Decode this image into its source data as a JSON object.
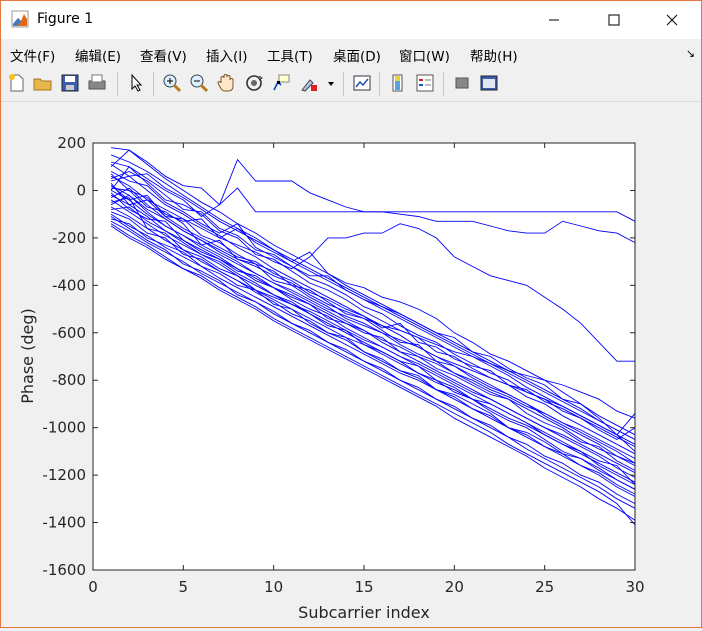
{
  "window": {
    "title": "Figure 1",
    "minimize": "—",
    "maximize": "☐",
    "close": "✕"
  },
  "menu": {
    "items": [
      "文件(F)",
      "编辑(E)",
      "查看(V)",
      "插入(I)",
      "工具(T)",
      "桌面(D)",
      "窗口(W)",
      "帮助(H)"
    ],
    "overflow": "↘"
  },
  "toolbar": {
    "icons": [
      "new-figure-icon",
      "open-file-icon",
      "save-icon",
      "print-icon",
      "select-arrow-icon",
      "zoom-in-icon",
      "zoom-out-icon",
      "pan-hand-icon",
      "rotate-3d-icon",
      "data-cursor-icon",
      "brush-icon",
      "brush-dropdown-icon",
      "link-plot-icon",
      "colorbar-icon",
      "legend-icon",
      "hide-plot-tools-icon",
      "show-plot-tools-icon"
    ]
  },
  "chart_data": {
    "type": "line",
    "title": "",
    "xlabel": "Subcarrier index",
    "ylabel": "Phase (deg)",
    "xlim": [
      0,
      30
    ],
    "ylim": [
      -1600,
      200
    ],
    "xticks": [
      0,
      5,
      10,
      15,
      20,
      25,
      30
    ],
    "yticks": [
      200,
      0,
      -200,
      -400,
      -600,
      -800,
      -1000,
      -1200,
      -1400,
      -1600
    ],
    "line_color": "#0000ff",
    "grid": false,
    "x": [
      1,
      2,
      3,
      4,
      5,
      6,
      7,
      8,
      9,
      10,
      11,
      12,
      13,
      14,
      15,
      16,
      17,
      18,
      19,
      20,
      21,
      22,
      23,
      24,
      25,
      26,
      27,
      28,
      29,
      30
    ],
    "series": [
      {
        "values": [
          180,
          170,
          120,
          60,
          20,
          10,
          -60,
          130,
          40,
          40,
          40,
          -10,
          -40,
          -70,
          -90,
          -90,
          -90,
          -90,
          -90,
          -90,
          -90,
          -90,
          -90,
          -90,
          -90,
          -90,
          -90,
          -90,
          -90,
          -130
        ]
      },
      {
        "values": [
          120,
          100,
          50,
          0,
          -40,
          -110,
          -60,
          10,
          -90,
          -90,
          -90,
          -90,
          -90,
          -90,
          -90,
          -90,
          -100,
          -110,
          -130,
          -130,
          -130,
          -150,
          -170,
          -180,
          -180,
          -130,
          -150,
          -170,
          -180,
          -220
        ]
      },
      {
        "values": [
          60,
          20,
          -40,
          -80,
          -120,
          -160,
          -200,
          -230,
          -260,
          -300,
          -330,
          -280,
          -200,
          -200,
          -180,
          -180,
          -140,
          -160,
          -200,
          -280,
          -320,
          -360,
          -380,
          -400,
          -450,
          -500,
          -560,
          -640,
          -720,
          -720
        ]
      },
      {
        "values": [
          20,
          -20,
          -80,
          -120,
          -170,
          -210,
          -250,
          -290,
          -320,
          -360,
          -390,
          -440,
          -480,
          -510,
          -540,
          -570,
          -590,
          -620,
          -650,
          -680,
          -700,
          -730,
          -760,
          -780,
          -800,
          -820,
          -850,
          -880,
          -930,
          -960
        ]
      },
      {
        "values": [
          0,
          -40,
          -100,
          -150,
          -190,
          -230,
          -270,
          -310,
          -350,
          -390,
          -420,
          -460,
          -500,
          -530,
          -560,
          -600,
          -630,
          -660,
          -700,
          -730,
          -760,
          -790,
          -820,
          -850,
          -880,
          -910,
          -950,
          -990,
          -1030,
          -1070
        ]
      },
      {
        "values": [
          -20,
          -60,
          -110,
          -170,
          -210,
          -250,
          -290,
          -330,
          -370,
          -410,
          -450,
          -480,
          -520,
          -560,
          -590,
          -630,
          -660,
          -700,
          -730,
          -770,
          -800,
          -840,
          -870,
          -910,
          -940,
          -980,
          -1010,
          -1050,
          -1090,
          -1130
        ]
      },
      {
        "values": [
          -40,
          -90,
          -140,
          -190,
          -230,
          -270,
          -310,
          -360,
          -400,
          -440,
          -480,
          -510,
          -550,
          -590,
          -630,
          -660,
          -700,
          -730,
          -770,
          -810,
          -850,
          -880,
          -920,
          -960,
          -1000,
          -1030,
          -1070,
          -1110,
          -1150,
          -1190
        ]
      },
      {
        "values": [
          -70,
          -110,
          -160,
          -210,
          -250,
          -300,
          -340,
          -380,
          -420,
          -460,
          -500,
          -540,
          -580,
          -620,
          -650,
          -690,
          -730,
          -770,
          -810,
          -840,
          -880,
          -920,
          -960,
          -990,
          -1030,
          -1070,
          -1110,
          -1150,
          -1190,
          -1230
        ]
      },
      {
        "values": [
          -100,
          -150,
          -190,
          -240,
          -280,
          -320,
          -370,
          -410,
          -450,
          -490,
          -530,
          -570,
          -610,
          -650,
          -690,
          -730,
          -770,
          -800,
          -840,
          -880,
          -920,
          -960,
          -1000,
          -1040,
          -1080,
          -1120,
          -1160,
          -1200,
          -1250,
          -1290
        ]
      },
      {
        "values": [
          -130,
          -170,
          -220,
          -260,
          -300,
          -350,
          -390,
          -430,
          -470,
          -520,
          -560,
          -600,
          -640,
          -680,
          -720,
          -760,
          -800,
          -840,
          -880,
          -920,
          -960,
          -1000,
          -1040,
          -1090,
          -1130,
          -1170,
          -1210,
          -1250,
          -1300,
          -1340
        ]
      },
      {
        "values": [
          -150,
          -200,
          -240,
          -290,
          -330,
          -370,
          -420,
          -460,
          -500,
          -550,
          -590,
          -630,
          -670,
          -710,
          -750,
          -790,
          -830,
          -870,
          -910,
          -960,
          -1000,
          -1040,
          -1080,
          -1120,
          -1170,
          -1210,
          -1250,
          -1300,
          -1340,
          -1390
        ]
      },
      {
        "values": [
          10,
          0,
          -30,
          -100,
          -130,
          -120,
          -200,
          -160,
          -220,
          -260,
          -300,
          -260,
          -350,
          -390,
          -410,
          -450,
          -470,
          -500,
          -540,
          -600,
          -640,
          -690,
          -720,
          -760,
          -800,
          -850,
          -900,
          -960,
          -1030,
          -1100
        ]
      },
      {
        "values": [
          80,
          40,
          20,
          -50,
          -90,
          -140,
          -180,
          -140,
          -240,
          -280,
          -320,
          -360,
          -360,
          -420,
          -460,
          -490,
          -520,
          -560,
          -600,
          -620,
          -680,
          -700,
          -750,
          -790,
          -820,
          -880,
          -900,
          -950,
          -990,
          -1030
        ]
      },
      {
        "values": [
          30,
          -60,
          -40,
          -110,
          -160,
          -200,
          -240,
          -280,
          -300,
          -350,
          -380,
          -430,
          -460,
          -500,
          -530,
          -580,
          -560,
          -640,
          -660,
          -710,
          -740,
          -760,
          -820,
          -840,
          -890,
          -920,
          -960,
          -1000,
          -1040,
          -1080
        ]
      },
      {
        "values": [
          -10,
          -80,
          -120,
          -130,
          -210,
          -260,
          -290,
          -340,
          -360,
          -410,
          -440,
          -480,
          -540,
          -560,
          -600,
          -620,
          -680,
          -700,
          -750,
          -780,
          -820,
          -860,
          -880,
          -940,
          -980,
          -1010,
          -1060,
          -1080,
          -1140,
          -1180
        ]
      },
      {
        "values": [
          -50,
          -30,
          -160,
          -180,
          -250,
          -280,
          -330,
          -360,
          -420,
          -450,
          -480,
          -520,
          -560,
          -600,
          -640,
          -680,
          -720,
          -740,
          -800,
          -830,
          -880,
          -900,
          -940,
          -980,
          -1020,
          -1060,
          -1100,
          -1140,
          -1160,
          -1240
        ]
      },
      {
        "values": [
          -120,
          -140,
          -200,
          -230,
          -260,
          -320,
          -350,
          -400,
          -420,
          -480,
          -500,
          -560,
          -600,
          -620,
          -680,
          -720,
          -760,
          -780,
          -840,
          -860,
          -900,
          -940,
          -1000,
          -1020,
          -1060,
          -1110,
          -1130,
          -1180,
          -1220,
          -1260
        ]
      },
      {
        "values": [
          150,
          120,
          80,
          30,
          -20,
          -70,
          -120,
          -160,
          -200,
          -250,
          -290,
          -330,
          -370,
          -410,
          -450,
          -490,
          -530,
          -570,
          -610,
          -650,
          -690,
          -730,
          -770,
          -810,
          -850,
          -890,
          -930,
          -970,
          -1010,
          -1050
        ]
      },
      {
        "values": [
          100,
          170,
          110,
          50,
          0,
          -50,
          -90,
          -140,
          -180,
          -230,
          -270,
          -310,
          -350,
          -400,
          -440,
          -480,
          -520,
          -560,
          -600,
          -640,
          -680,
          -720,
          -760,
          -800,
          -840,
          -880,
          -920,
          -970,
          -1010,
          -1050
        ]
      },
      {
        "values": [
          40,
          60,
          0,
          -60,
          -100,
          -150,
          -190,
          -240,
          -280,
          -330,
          -370,
          -410,
          -450,
          -490,
          -530,
          -570,
          -610,
          -660,
          -700,
          -740,
          -780,
          -820,
          -860,
          -900,
          -940,
          -980,
          -1020,
          -1060,
          -1100,
          -1150
        ]
      },
      {
        "values": [
          -30,
          10,
          -60,
          -120,
          -170,
          -210,
          -260,
          -300,
          -350,
          -390,
          -430,
          -470,
          -510,
          -550,
          -590,
          -640,
          -680,
          -720,
          -760,
          -800,
          -840,
          -880,
          -920,
          -960,
          -1000,
          -1040,
          -1080,
          -1120,
          -1170,
          -1210
        ]
      },
      {
        "values": [
          70,
          0,
          -70,
          -90,
          -140,
          -230,
          -210,
          -290,
          -310,
          -380,
          -400,
          -450,
          -490,
          -540,
          -570,
          -600,
          -650,
          -690,
          -720,
          -770,
          -810,
          -850,
          -880,
          -920,
          -960,
          -1000,
          -1050,
          -1090,
          -1120,
          -1160
        ]
      },
      {
        "values": [
          0,
          100,
          30,
          -40,
          -60,
          -100,
          -170,
          -200,
          -270,
          -290,
          -340,
          -390,
          -420,
          -460,
          -510,
          -550,
          -590,
          -620,
          -680,
          -700,
          -750,
          -790,
          -820,
          -870,
          -900,
          -950,
          -990,
          -1030,
          -1070,
          -1110
        ]
      },
      {
        "values": [
          -60,
          -20,
          -90,
          -150,
          -190,
          -240,
          -280,
          -330,
          -380,
          -410,
          -460,
          -500,
          -530,
          -580,
          -620,
          -660,
          -700,
          -740,
          -780,
          -820,
          -860,
          -900,
          -940,
          -980,
          -1030,
          -1070,
          -1100,
          -1160,
          -1200,
          -1240
        ]
      },
      {
        "values": [
          -90,
          -120,
          -180,
          -200,
          -270,
          -290,
          -340,
          -380,
          -430,
          -470,
          -520,
          -550,
          -600,
          -630,
          -680,
          -710,
          -760,
          -790,
          -840,
          -870,
          -920,
          -950,
          -1000,
          -1030,
          -1080,
          -1110,
          -1160,
          -1190,
          -1240,
          -1280
        ]
      },
      {
        "values": [
          20,
          -40,
          -20,
          -110,
          -120,
          -190,
          -220,
          -270,
          -310,
          -340,
          -400,
          -420,
          -470,
          -520,
          -540,
          -590,
          -640,
          -650,
          -720,
          -740,
          -790,
          -830,
          -860,
          -900,
          -950,
          -990,
          -1030,
          -1070,
          -1120,
          -1150
        ]
      },
      {
        "values": [
          -110,
          -160,
          -210,
          -250,
          -310,
          -340,
          -380,
          -440,
          -470,
          -510,
          -560,
          -590,
          -640,
          -670,
          -720,
          -750,
          -800,
          -830,
          -880,
          -910,
          -960,
          -990,
          -1040,
          -1070,
          -1120,
          -1150,
          -1200,
          -1230,
          -1280,
          -1320
        ]
      },
      {
        "values": [
          50,
          80,
          40,
          -20,
          -80,
          -90,
          -160,
          -190,
          -250,
          -270,
          -320,
          -370,
          -400,
          -440,
          -490,
          -520,
          -570,
          -610,
          -640,
          -690,
          -730,
          -770,
          -800,
          -850,
          -880,
          -930,
          -960,
          -1010,
          -1050,
          -1000
        ]
      },
      {
        "values": [
          -80,
          -70,
          -130,
          -170,
          -220,
          -270,
          -300,
          -350,
          -390,
          -440,
          -470,
          -520,
          -570,
          -590,
          -650,
          -680,
          -720,
          -770,
          -800,
          -850,
          -880,
          -930,
          -970,
          -1000,
          -1050,
          -1100,
          -1130,
          -1170,
          -1220,
          -1260
        ]
      },
      {
        "values": [
          110,
          60,
          70,
          10,
          -30,
          -80,
          -130,
          -170,
          -210,
          -250,
          -300,
          -340,
          -380,
          -420,
          -460,
          -500,
          -540,
          -580,
          -620,
          -660,
          -700,
          -740,
          -780,
          -830,
          -870,
          -910,
          -950,
          -990,
          -1030,
          -940
        ]
      },
      {
        "values": [
          -140,
          -190,
          -230,
          -280,
          -330,
          -360,
          -410,
          -450,
          -490,
          -540,
          -580,
          -620,
          -660,
          -700,
          -740,
          -780,
          -820,
          -860,
          -900,
          -940,
          -980,
          -1020,
          -1070,
          -1110,
          -1150,
          -1190,
          -1230,
          -1270,
          -1320,
          -1410
        ]
      }
    ]
  }
}
